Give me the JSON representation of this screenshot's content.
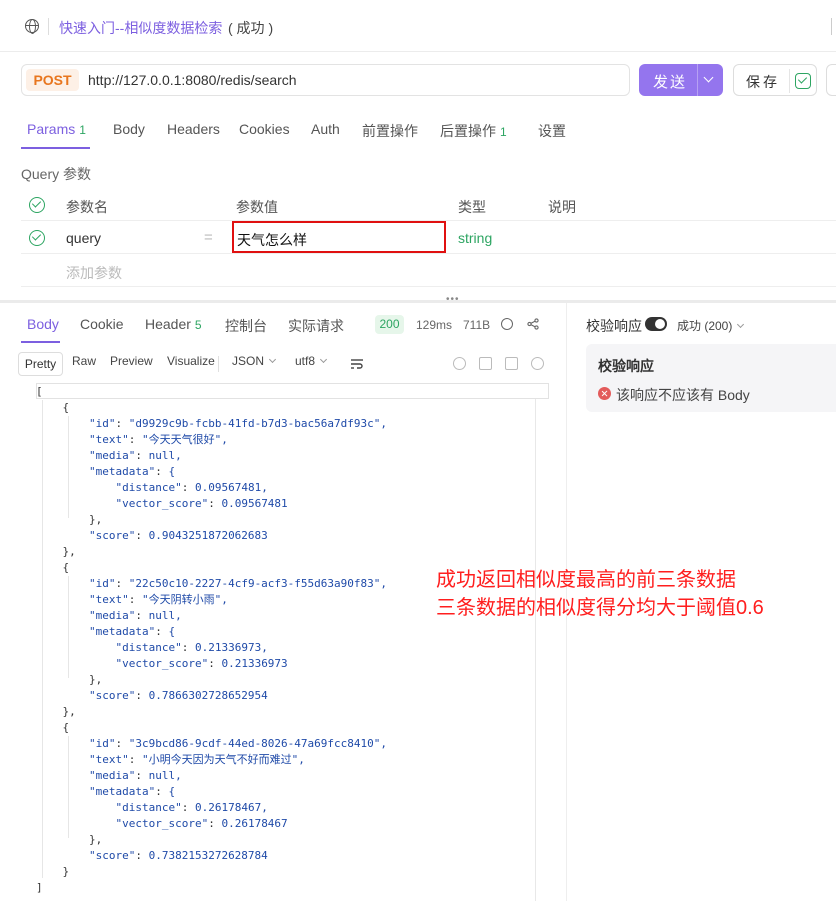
{
  "header": {
    "title": "快速入门--相似度数据检索",
    "status": "( 成功 )"
  },
  "request": {
    "method": "POST",
    "url": "http://127.0.0.1:8080/redis/search",
    "send_label": "发送",
    "save_label": "保存"
  },
  "request_tabs": [
    {
      "label": "Params",
      "count": "1"
    },
    {
      "label": "Body",
      "count": ""
    },
    {
      "label": "Headers",
      "count": ""
    },
    {
      "label": "Cookies",
      "count": ""
    },
    {
      "label": "Auth",
      "count": ""
    },
    {
      "label": "前置操作",
      "count": ""
    },
    {
      "label": "后置操作",
      "count": "1"
    },
    {
      "label": "设置",
      "count": ""
    }
  ],
  "params": {
    "section_label": "Query 参数",
    "columns": [
      "参数名",
      "参数值",
      "类型",
      "说明"
    ],
    "rows": [
      {
        "name": "query",
        "eq": "=",
        "value": "天气怎么样",
        "type": "string",
        "desc": ""
      }
    ],
    "add_placeholder": "添加参数"
  },
  "response_tabs": [
    {
      "label": "Body",
      "count": ""
    },
    {
      "label": "Cookie",
      "count": ""
    },
    {
      "label": "Header",
      "count": "5"
    },
    {
      "label": "控制台",
      "count": ""
    },
    {
      "label": "实际请求",
      "count": ""
    }
  ],
  "response_meta": {
    "status_code": "200",
    "time": "129ms",
    "size": "711B"
  },
  "format_bar": {
    "views": [
      "Pretty",
      "Raw",
      "Preview",
      "Visualize"
    ],
    "format": "JSON",
    "encoding": "utf8"
  },
  "json_lines": [
    {
      "indent": 0,
      "text": "["
    },
    {
      "indent": 1,
      "text": "{"
    },
    {
      "indent": 2,
      "key": "\"id\"",
      "value": "\"d9929c9b-fcbb-41fd-b7d3-bac56a7df93c\","
    },
    {
      "indent": 2,
      "key": "\"text\"",
      "value": "\"今天天气很好\","
    },
    {
      "indent": 2,
      "key": "\"media\"",
      "value": "null,"
    },
    {
      "indent": 2,
      "key": "\"metadata\"",
      "value": "{"
    },
    {
      "indent": 3,
      "key": "\"distance\"",
      "value": "0.09567481,"
    },
    {
      "indent": 3,
      "key": "\"vector_score\"",
      "value": "0.09567481"
    },
    {
      "indent": 2,
      "text": "},"
    },
    {
      "indent": 2,
      "key": "\"score\"",
      "value": "0.9043251872062683"
    },
    {
      "indent": 1,
      "text": "},"
    },
    {
      "indent": 1,
      "text": "{"
    },
    {
      "indent": 2,
      "key": "\"id\"",
      "value": "\"22c50c10-2227-4cf9-acf3-f55d63a90f83\","
    },
    {
      "indent": 2,
      "key": "\"text\"",
      "value": "\"今天阴转小雨\","
    },
    {
      "indent": 2,
      "key": "\"media\"",
      "value": "null,"
    },
    {
      "indent": 2,
      "key": "\"metadata\"",
      "value": "{"
    },
    {
      "indent": 3,
      "key": "\"distance\"",
      "value": "0.21336973,"
    },
    {
      "indent": 3,
      "key": "\"vector_score\"",
      "value": "0.21336973"
    },
    {
      "indent": 2,
      "text": "},"
    },
    {
      "indent": 2,
      "key": "\"score\"",
      "value": "0.7866302728652954"
    },
    {
      "indent": 1,
      "text": "},"
    },
    {
      "indent": 1,
      "text": "{"
    },
    {
      "indent": 2,
      "key": "\"id\"",
      "value": "\"3c9bcd86-9cdf-44ed-8026-47a69fcc8410\","
    },
    {
      "indent": 2,
      "key": "\"text\"",
      "value": "\"小明今天因为天气不好而难过\","
    },
    {
      "indent": 2,
      "key": "\"media\"",
      "value": "null,"
    },
    {
      "indent": 2,
      "key": "\"metadata\"",
      "value": "{"
    },
    {
      "indent": 3,
      "key": "\"distance\"",
      "value": "0.26178467,"
    },
    {
      "indent": 3,
      "key": "\"vector_score\"",
      "value": "0.26178467"
    },
    {
      "indent": 2,
      "text": "},"
    },
    {
      "indent": 2,
      "key": "\"score\"",
      "value": "0.7382153272628784"
    },
    {
      "indent": 1,
      "text": "}"
    },
    {
      "indent": 0,
      "text": "]"
    }
  ],
  "annotation": {
    "line1": "成功返回相似度最高的前三条数据",
    "line2": "三条数据的相似度得分均大于阈值0.6"
  },
  "validation": {
    "title": "校验响应",
    "status": "成功 (200)",
    "card_title": "校验响应",
    "error": "该响应不应该有 Body"
  },
  "colors": {
    "accent": "#7c5fe0",
    "send_button": "#9475ee",
    "method": "#e8761e",
    "success": "#2da562",
    "annotation": "#ff1e1e",
    "highlight_box": "#e01010"
  }
}
